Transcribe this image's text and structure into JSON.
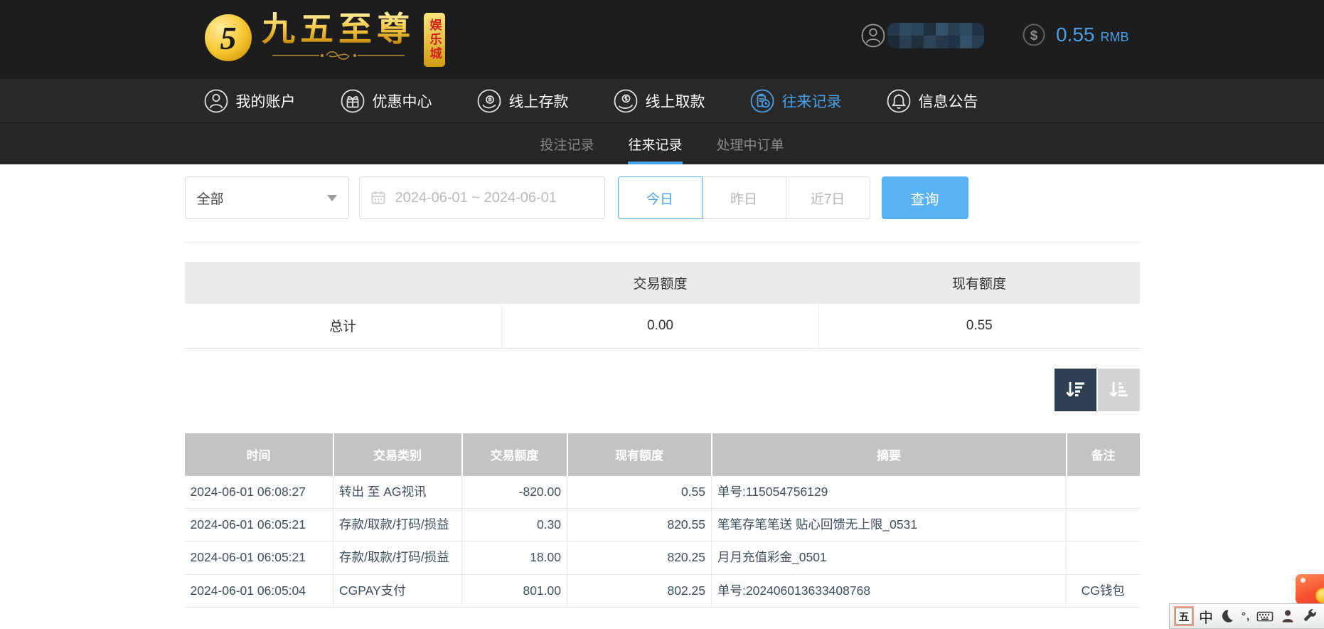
{
  "colors": {
    "header_bg": "#1d1d1d",
    "accent_blue": "#4aa0e8",
    "button_blue": "#58b1f0",
    "sort_active_bg": "#2d3e50",
    "table_header_bg": "#c3c3c3"
  },
  "header": {
    "logo": {
      "coin_glyph": "5",
      "brand": "九五至尊",
      "badge": "娱乐城"
    },
    "balance": {
      "amount": "0.55",
      "currency": "RMB"
    }
  },
  "nav": {
    "items": [
      {
        "label": "我的账户",
        "icon": "user-icon"
      },
      {
        "label": "优惠中心",
        "icon": "gift-icon"
      },
      {
        "label": "线上存款",
        "icon": "deposit-icon"
      },
      {
        "label": "线上取款",
        "icon": "withdraw-icon"
      },
      {
        "label": "往来记录",
        "icon": "records-icon"
      },
      {
        "label": "信息公告",
        "icon": "bell-icon"
      }
    ]
  },
  "subtabs": {
    "items": [
      {
        "label": "投注记录"
      },
      {
        "label": "往来记录"
      },
      {
        "label": "处理中订单"
      }
    ]
  },
  "filters": {
    "type_selected": "全部",
    "date_range": "2024-06-01 ~ 2024-06-01",
    "quick": [
      {
        "label": "今日"
      },
      {
        "label": "昨日"
      },
      {
        "label": "近7日"
      }
    ],
    "query_label": "查询"
  },
  "summary": {
    "headers": {
      "transaction": "交易额度",
      "balance": "现有额度"
    },
    "total_label": "总计",
    "transaction_total": "0.00",
    "balance_total": "0.55"
  },
  "records": {
    "headers": [
      "时间",
      "交易类别",
      "交易额度",
      "现有额度",
      "摘要",
      "备注"
    ],
    "rows": [
      [
        "2024-06-01 06:08:27",
        "转出 至 AG视讯",
        "-820.00",
        "0.55",
        "单号:115054756129",
        ""
      ],
      [
        "2024-06-01 06:05:21",
        "存款/取款/打码/损益",
        "0.30",
        "820.55",
        "笔笔存笔笔送 贴心回馈无上限_0531",
        ""
      ],
      [
        "2024-06-01 06:05:21",
        "存款/取款/打码/损益",
        "18.00",
        "820.25",
        "月月充值彩金_0501",
        ""
      ],
      [
        "2024-06-01 06:05:04",
        "CGPAY支付",
        "801.00",
        "802.25",
        "单号:202406013633408768",
        "CG钱包"
      ]
    ]
  },
  "ime": {
    "wubi": "五",
    "mode": "中",
    "punct": "°,"
  }
}
